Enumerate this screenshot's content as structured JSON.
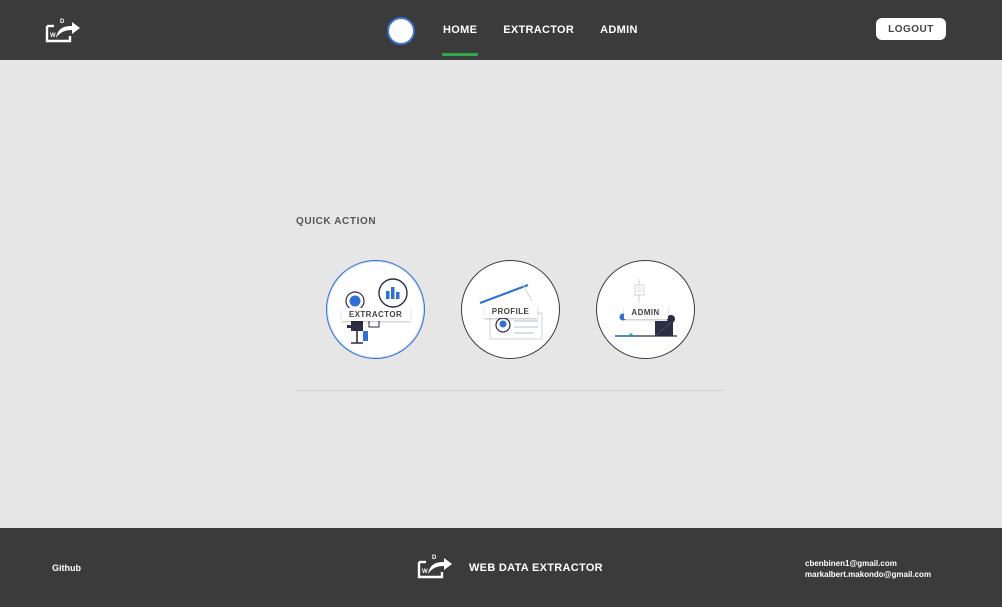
{
  "header": {
    "logo_letters": {
      "top": "D",
      "left": "W"
    },
    "nav": [
      {
        "label": "HOME",
        "active": true
      },
      {
        "label": "EXTRACTOR",
        "active": false
      },
      {
        "label": "ADMIN",
        "active": false
      }
    ],
    "logout_label": "LOGOUT"
  },
  "quick_action": {
    "title": "QUICK ACTION",
    "cards": [
      {
        "label": "EXTRACTOR",
        "selected": true
      },
      {
        "label": "PROFILE",
        "selected": false
      },
      {
        "label": "ADMIN",
        "selected": false
      }
    ]
  },
  "footer": {
    "github_label": "Github",
    "brand": "WEB DATA EXTRACTOR",
    "emails": [
      "cbenbinen1@gmail.com",
      "markalbert.makondo@gmail.com"
    ]
  },
  "colors": {
    "bar_bg": "#3b3b3b",
    "page_bg": "#e6e6e6",
    "accent_blue": "#2f6fd6",
    "active_green": "#2fa84f"
  }
}
